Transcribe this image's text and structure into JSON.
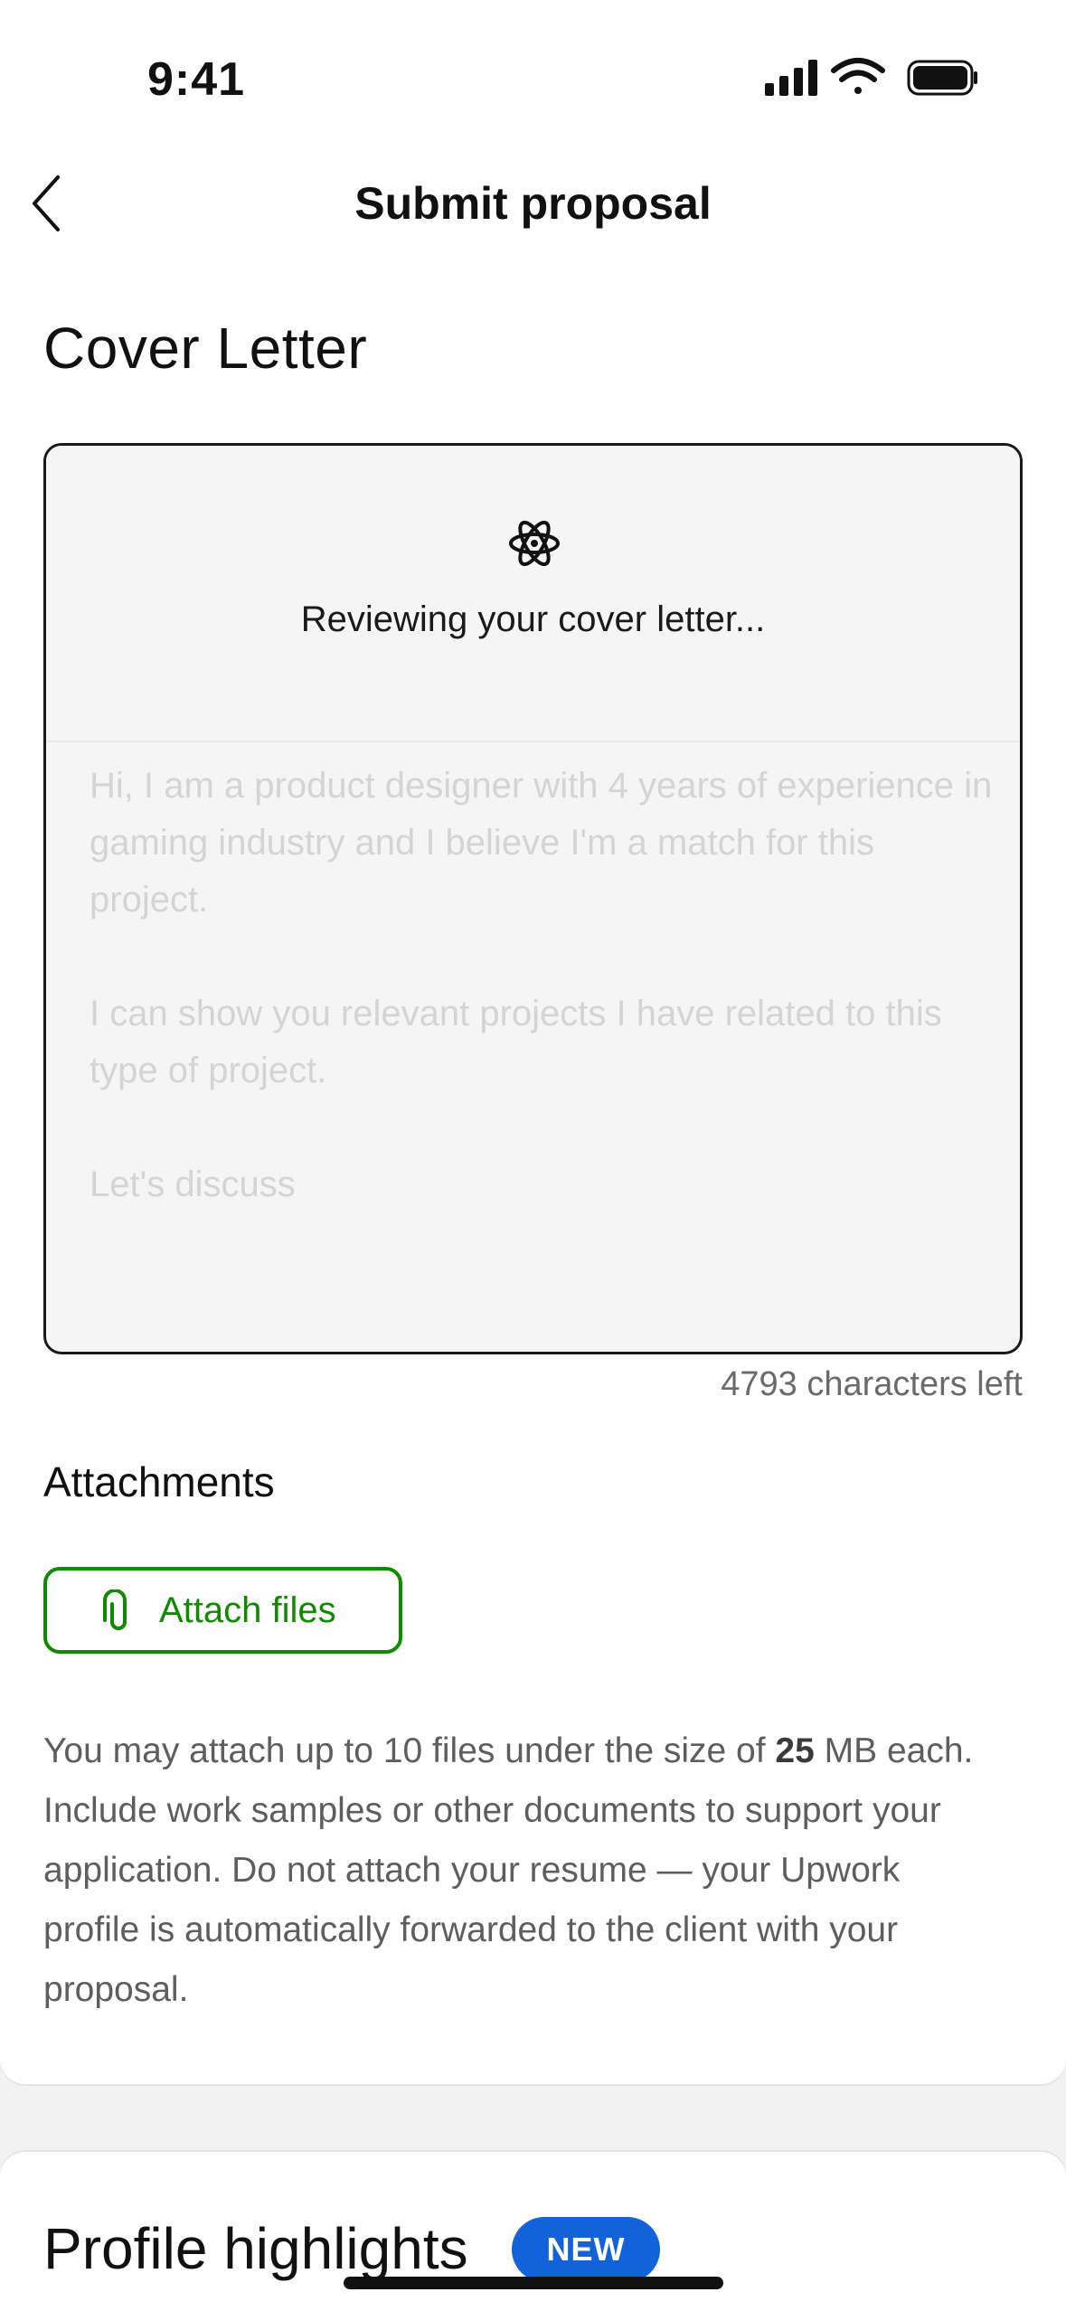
{
  "status_bar": {
    "time": "9:41"
  },
  "nav": {
    "title": "Submit proposal"
  },
  "cover_letter": {
    "section_title": "Cover Letter",
    "reviewing_text": "Reviewing your cover letter...",
    "paragraphs": [
      "Hi, I am a product designer with 4 years of experience in gaming industry and I believe I'm a match for this project.",
      "I can show you relevant projects I have related to this type of project.",
      "Let's discuss"
    ],
    "characters_left": "4793 characters left"
  },
  "attachments": {
    "title": "Attachments",
    "button_label": "Attach files",
    "help_before": "You may attach up to 10 files under the size of ",
    "help_size": "25",
    "help_after": " MB each. Include work samples or other documents to support your application. Do not attach your resume — your Upwork profile is automatically forwarded to the client with your proposal."
  },
  "profile_highlights": {
    "title": "Profile highlights",
    "badge": "NEW"
  },
  "colors": {
    "accent_green": "#108a00",
    "badge_blue": "#1262d9"
  },
  "icons": {
    "back": "chevron-left-icon",
    "review": "atom-icon",
    "attach": "paperclip-icon"
  }
}
